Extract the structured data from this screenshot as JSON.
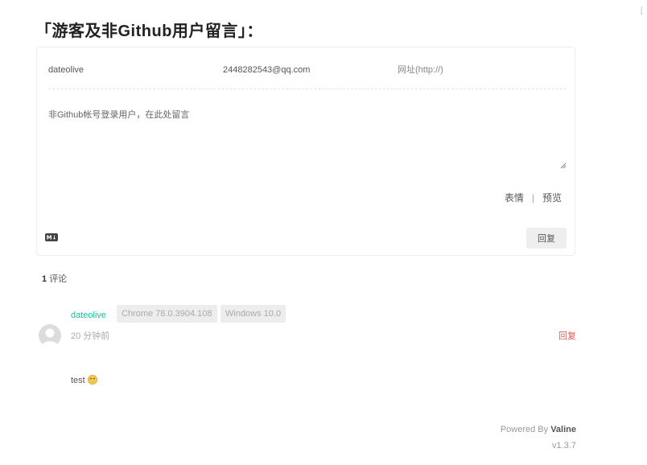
{
  "header": {
    "title": "「游客及非Github用户留言」：",
    "corner": "["
  },
  "form": {
    "nick_value": "dateolive",
    "mail_value": "2448282543@qq.com",
    "link_placeholder": "网址(http://)",
    "editor_placeholder": "非Github帐号登录用户，在此处留言",
    "emoji_label": "表情",
    "separator": "|",
    "preview_label": "预览",
    "markdown_label": "M↓",
    "reply_label": "回复"
  },
  "comments": {
    "count": "1",
    "count_label": "评论",
    "items": [
      {
        "nick": "dateolive",
        "browser": "Chrome 78.0.3904.108",
        "os": "Windows 10.0",
        "time": "20 分钟前",
        "reply_label": "回复",
        "content": "test",
        "emoji": "grinning-emoji"
      }
    ]
  },
  "footer": {
    "powered_prefix": "Powered By",
    "powered_name": "Valine",
    "version": "v1.3.7"
  },
  "colors": {
    "nick": "#1abc9c",
    "reply": "#ef5350",
    "badge_bg": "#ededed"
  }
}
